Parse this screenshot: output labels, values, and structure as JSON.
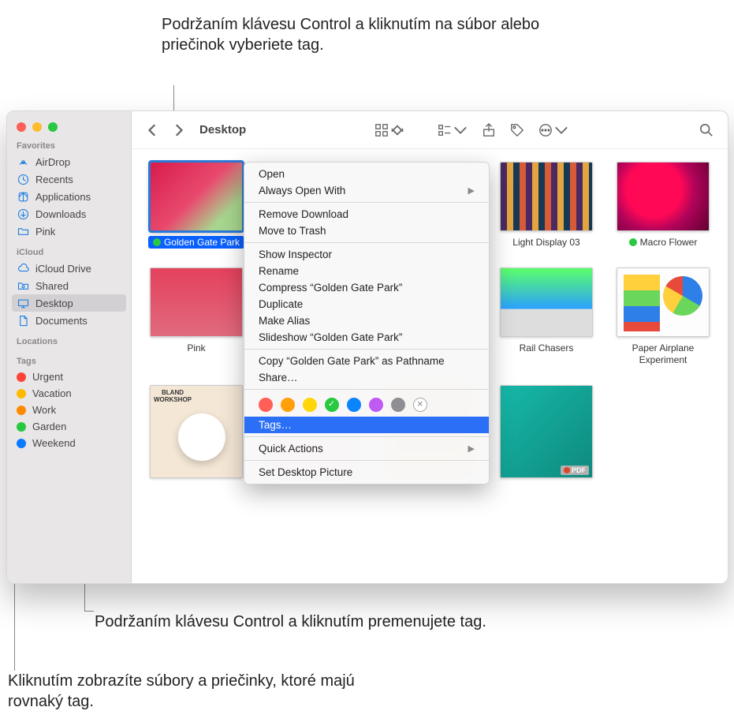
{
  "callouts": {
    "top": "Podržaním klávesu Control a kliknutím na súbor alebo priečinok vyberiete tag.",
    "bottom1": "Podržaním klávesu Control a kliknutím premenujete tag.",
    "bottom2": "Kliknutím zobrazíte súbory a priečinky, ktoré majú rovnaký tag."
  },
  "window": {
    "title": "Desktop"
  },
  "sidebar": {
    "sections": {
      "favorites": "Favorites",
      "icloud": "iCloud",
      "locations": "Locations",
      "tags": "Tags"
    },
    "favorites": [
      {
        "label": "AirDrop",
        "icon": "airdrop"
      },
      {
        "label": "Recents",
        "icon": "clock"
      },
      {
        "label": "Applications",
        "icon": "apps"
      },
      {
        "label": "Downloads",
        "icon": "download"
      },
      {
        "label": "Pink",
        "icon": "folder"
      }
    ],
    "icloud": [
      {
        "label": "iCloud Drive",
        "icon": "cloud"
      },
      {
        "label": "Shared",
        "icon": "shared"
      },
      {
        "label": "Desktop",
        "icon": "desktop",
        "selected": true
      },
      {
        "label": "Documents",
        "icon": "doc"
      }
    ],
    "tags": [
      {
        "label": "Urgent",
        "color": "#ff4539"
      },
      {
        "label": "Vacation",
        "color": "#ffb900"
      },
      {
        "label": "Work",
        "color": "#ff8a00"
      },
      {
        "label": "Garden",
        "color": "#28c840"
      },
      {
        "label": "Weekend",
        "color": "#0a7aff"
      }
    ]
  },
  "files": [
    {
      "name": "Golden Gate Park",
      "selected": true,
      "art": "art-flowers",
      "tag": "#28c840"
    },
    {
      "name": "",
      "art": "",
      "blank": true
    },
    {
      "name": "",
      "art": "",
      "blank": true
    },
    {
      "name": "Light Display 03",
      "art": "art-light"
    },
    {
      "name": "Macro Flower",
      "art": "art-macro",
      "tag": "#28c840"
    },
    {
      "name": "Pink",
      "art": "art-pink"
    },
    {
      "name": "",
      "art": "",
      "blank": true
    },
    {
      "name": "",
      "art": "",
      "blank": true
    },
    {
      "name": "Rail Chasers",
      "art": "art-rails"
    },
    {
      "name": "Paper Airplane Experiment",
      "art": "art-paper"
    },
    {
      "name": "",
      "art": "art-bland",
      "crop": true
    },
    {
      "name": "",
      "art": "art-pinkposter",
      "crop": true
    },
    {
      "name": "",
      "art": "art-orange",
      "crop": true,
      "pdf": true
    },
    {
      "name": "",
      "art": "art-marketing",
      "crop": true,
      "pdf": true
    },
    {
      "name": "",
      "art": "",
      "blank": true
    }
  ],
  "context_menu": {
    "items1": [
      "Open",
      "Always Open With"
    ],
    "items2": [
      "Remove Download",
      "Move to Trash"
    ],
    "items3": [
      "Show Inspector",
      "Rename",
      "Compress “Golden Gate Park”",
      "Duplicate",
      "Make Alias",
      "Slideshow “Golden Gate Park”"
    ],
    "items4": [
      "Copy “Golden Gate Park” as Pathname",
      "Share…"
    ],
    "tags_item": "Tags…",
    "items5": [
      "Quick Actions"
    ],
    "items6": [
      "Set Desktop Picture"
    ],
    "colors": [
      {
        "c": "#ff5f57"
      },
      {
        "c": "#ff9f0a"
      },
      {
        "c": "#ffd60a"
      },
      {
        "c": "#28c840",
        "check": true
      },
      {
        "c": "#0a84ff"
      },
      {
        "c": "#bf5af2"
      },
      {
        "c": "#8e8e93"
      },
      {
        "x": true
      }
    ],
    "submenu_indices": {
      "items1": 1,
      "items5": 0
    }
  },
  "pdf_badge": "PDF"
}
